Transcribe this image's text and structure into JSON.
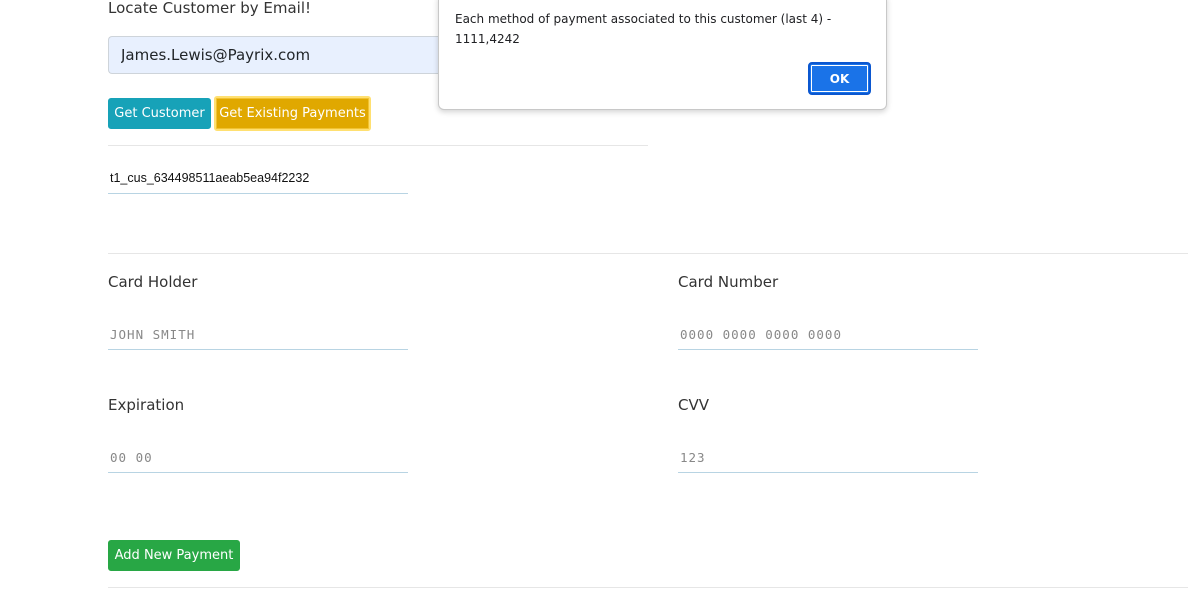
{
  "locate": {
    "label": "Locate Customer by Email!",
    "email_value": "James.Lewis@Payrix.com"
  },
  "buttons": {
    "get_customer": "Get Customer",
    "get_existing_payments": "Get Existing Payments",
    "add_new_payment": "Add New Payment"
  },
  "customer_id": "t1_cus_634498511aeab5ea94f2232",
  "form": {
    "card_holder": {
      "label": "Card Holder",
      "placeholder": "JOHN SMITH"
    },
    "card_number": {
      "label": "Card Number",
      "placeholder": "0000 0000 0000 0000"
    },
    "expiration": {
      "label": "Expiration",
      "placeholder": "00 00"
    },
    "cvv": {
      "label": "CVV",
      "placeholder": "123"
    }
  },
  "dialog": {
    "message_line1": "Each method of payment associated to this customer (last 4) -",
    "message_line2": "1111,4242",
    "ok_label": "OK"
  },
  "colors": {
    "info_button": "#17a2b8",
    "warning_button": "#e0a800",
    "success_button": "#28a745",
    "dialog_ok": "#1a73e8"
  }
}
